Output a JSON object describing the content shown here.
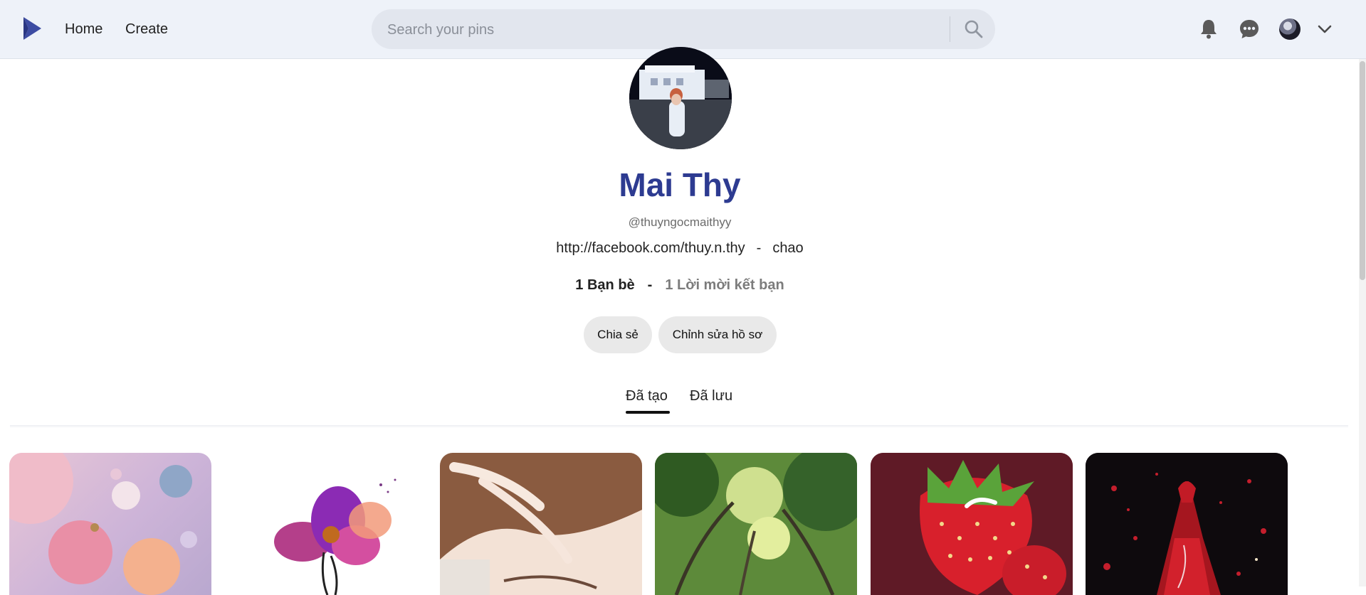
{
  "header": {
    "logo_icon": "brand-play-logo-icon",
    "nav": {
      "home_label": "Home",
      "create_label": "Create"
    },
    "search": {
      "placeholder": "Search your pins",
      "icon": "search-icon"
    },
    "icons": {
      "notifications": "bell-icon",
      "messages": "chat-icon",
      "account_menu": "chevron-down-icon"
    }
  },
  "profile": {
    "name": "Mai Thy",
    "handle": "@thuyngocmaithyy",
    "link": "http://facebook.com/thuy.n.thy",
    "link_separator": "-",
    "bio": "chao",
    "friends": "1 Bạn bè",
    "stats_separator": "-",
    "friend_requests": "1 Lời mời kết bạn",
    "buttons": {
      "share": "Chia sẻ",
      "edit": "Chỉnh sửa hồ sơ"
    },
    "tabs": {
      "created": "Đã tạo",
      "saved": "Đã lưu",
      "active": "created"
    }
  },
  "pins": [
    {
      "subject": "pastel spheres"
    },
    {
      "subject": "purple watercolor flower"
    },
    {
      "subject": "hair close-up"
    },
    {
      "subject": "forest canopy"
    },
    {
      "subject": "strawberries"
    },
    {
      "subject": "red dress"
    }
  ],
  "colors": {
    "header_bg": "#eef2f9",
    "name_color": "#2d3b91",
    "button_bg": "#e9e9e9"
  }
}
